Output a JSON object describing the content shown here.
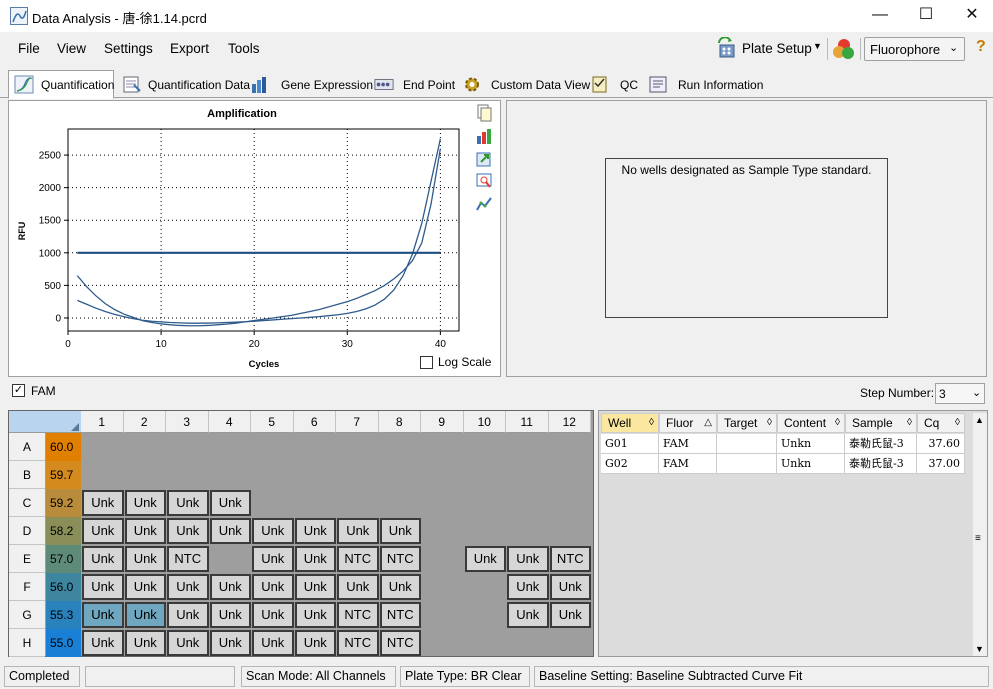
{
  "window": {
    "title": "Data Analysis - 唐-徐1.14.pcrd",
    "minimize": "—",
    "maximize": "☐",
    "close": "✕"
  },
  "menu": [
    "File",
    "View",
    "Settings",
    "Export",
    "Tools"
  ],
  "toolbar": {
    "plate_setup": "Plate Setup",
    "fluorophore": "Fluorophore",
    "help": "?"
  },
  "tabs": [
    {
      "label": "Quantification",
      "icon": "amplification-curve-icon",
      "active": true
    },
    {
      "label": "Quantification Data",
      "icon": "data-table-icon"
    },
    {
      "label": "Gene Expression",
      "icon": "bar-chart-icon"
    },
    {
      "label": "End Point",
      "icon": "end-point-icon"
    },
    {
      "label": "Custom Data View",
      "icon": "gear-icon"
    },
    {
      "label": "QC",
      "icon": "qc-checklist-icon"
    },
    {
      "label": "Run Information",
      "icon": "run-info-icon"
    }
  ],
  "chart_data": {
    "type": "line",
    "title": "Amplification",
    "xlabel": "Cycles",
    "ylabel": "RFU",
    "xlim": [
      0,
      42
    ],
    "ylim": [
      -200,
      2900
    ],
    "xticks": [
      0,
      10,
      20,
      30,
      40
    ],
    "yticks": [
      0,
      500,
      1000,
      1500,
      2000,
      2500
    ],
    "grid": true,
    "series": [
      {
        "x": [
          1,
          2,
          3,
          4,
          5,
          6,
          7,
          8,
          9,
          10,
          11,
          12,
          13,
          14,
          15,
          16,
          17,
          18,
          19,
          20,
          21,
          22,
          23,
          24,
          25,
          26,
          27,
          28,
          29,
          30,
          31,
          32,
          33,
          34,
          35,
          36,
          37,
          38,
          39,
          40
        ],
        "values": [
          650,
          480,
          340,
          220,
          130,
          60,
          10,
          -40,
          -70,
          -90,
          -105,
          -115,
          -120,
          -120,
          -115,
          -105,
          -95,
          -80,
          -60,
          -40,
          -20,
          0,
          20,
          40,
          70,
          100,
          130,
          170,
          210,
          250,
          300,
          360,
          420,
          500,
          600,
          720,
          880,
          1150,
          1750,
          2600
        ]
      },
      {
        "x": [
          1,
          2,
          3,
          4,
          5,
          6,
          7,
          8,
          9,
          10,
          11,
          12,
          13,
          14,
          15,
          16,
          17,
          18,
          19,
          20,
          21,
          22,
          23,
          24,
          25,
          26,
          27,
          28,
          29,
          30,
          31,
          32,
          33,
          34,
          35,
          36,
          37,
          38,
          39,
          40
        ],
        "values": [
          270,
          210,
          150,
          100,
          55,
          20,
          -10,
          -35,
          -50,
          -60,
          -70,
          -75,
          -80,
          -80,
          -78,
          -75,
          -70,
          -65,
          -58,
          -50,
          -40,
          -30,
          -20,
          -10,
          0,
          10,
          20,
          35,
          50,
          70,
          100,
          140,
          200,
          290,
          430,
          650,
          980,
          1450,
          2100,
          2750
        ]
      }
    ],
    "threshold": 1000,
    "log_scale_label": "Log Scale",
    "log_scale": false
  },
  "standard_curve": {
    "message": "No wells designated as Sample Type standard."
  },
  "fam": {
    "label": "FAM",
    "checked": true
  },
  "step": {
    "label": "Step Number:",
    "value": "3"
  },
  "plate": {
    "columns": [
      "1",
      "2",
      "3",
      "4",
      "5",
      "6",
      "7",
      "8",
      "9",
      "10",
      "11",
      "12"
    ],
    "rows": [
      {
        "label": "A",
        "temp": "60.0",
        "color": "#e07f00",
        "wells": [
          "",
          "",
          "",
          "",
          "",
          "",
          "",
          "",
          "",
          "",
          "",
          ""
        ]
      },
      {
        "label": "B",
        "temp": "59.7",
        "color": "#d48a1c",
        "wells": [
          "",
          "",
          "",
          "",
          "",
          "",
          "",
          "",
          "",
          "",
          "",
          ""
        ]
      },
      {
        "label": "C",
        "temp": "59.2",
        "color": "#b88c3a",
        "wells": [
          "Unk",
          "Unk",
          "Unk",
          "Unk",
          "",
          "",
          "",
          "",
          "",
          "",
          "",
          ""
        ]
      },
      {
        "label": "D",
        "temp": "58.2",
        "color": "#8a8e58",
        "wells": [
          "Unk",
          "Unk",
          "Unk",
          "Unk",
          "Unk",
          "Unk",
          "Unk",
          "Unk",
          "",
          "",
          "",
          ""
        ]
      },
      {
        "label": "E",
        "temp": "57.0",
        "color": "#5e8a78",
        "wells": [
          "Unk",
          "Unk",
          "NTC",
          "",
          "Unk",
          "Unk",
          "NTC",
          "NTC",
          "",
          "Unk",
          "Unk",
          "NTC"
        ]
      },
      {
        "label": "F",
        "temp": "56.0",
        "color": "#3e85a0",
        "wells": [
          "Unk",
          "Unk",
          "Unk",
          "Unk",
          "Unk",
          "Unk",
          "Unk",
          "Unk",
          "",
          "",
          "Unk",
          "Unk"
        ]
      },
      {
        "label": "G",
        "temp": "55.3",
        "color": "#2a82bc",
        "wells": [
          "Unk",
          "Unk",
          "Unk",
          "Unk",
          "Unk",
          "Unk",
          "NTC",
          "NTC",
          "",
          "",
          "Unk",
          "Unk"
        ]
      },
      {
        "label": "H",
        "temp": "55.0",
        "color": "#1a80d6",
        "wells": [
          "Unk",
          "Unk",
          "Unk",
          "Unk",
          "Unk",
          "Unk",
          "NTC",
          "NTC",
          "",
          "",
          "",
          ""
        ]
      }
    ]
  },
  "results": {
    "headers": [
      "Well",
      "Fluor",
      "Target",
      "Content",
      "Sample",
      "Cq"
    ],
    "rows": [
      [
        "G01",
        "FAM",
        "",
        "Unkn",
        "泰勒氏鼠-3",
        "37.60"
      ],
      [
        "G02",
        "FAM",
        "",
        "Unkn",
        "泰勒氏鼠-3",
        "37.00"
      ]
    ]
  },
  "status": {
    "state": "Completed",
    "scan_mode": "Scan Mode: All Channels",
    "plate_type": "Plate Type: BR Clear",
    "baseline": "Baseline Setting: Baseline Subtracted Curve Fit"
  }
}
